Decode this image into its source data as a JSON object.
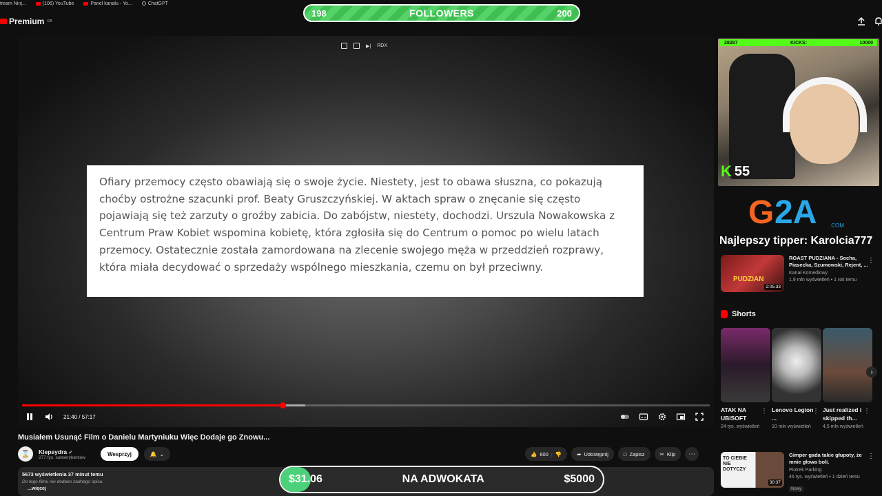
{
  "bookmarks": [
    {
      "label": "tream Ninj..."
    },
    {
      "label": "(106) YouTube"
    },
    {
      "label": "Panel kanału - Yo..."
    },
    {
      "label": "ChatGPT"
    }
  ],
  "header": {
    "logo_text": "Premium",
    "logo_country": "GB"
  },
  "followers_bar": {
    "current": "198",
    "label": "FOLLOWERS",
    "goal": "200",
    "progress": 0.99
  },
  "player": {
    "top_controls": {
      "label": "RDX"
    },
    "document_text": "Ofiary przemocy często obawiają się o swoje życie. Niestety, jest to obawa słuszna, co pokazują choćby ostrożne szacunki prof. Beaty Gruszczyńskiej. W aktach spraw o znęcanie się często pojawiają się też zarzuty o groźby zabicia. Do zabójstw, niestety, dochodzi. Urszula Nowakowska z Centrum Praw Kobiet wspomina kobietę, która zgłosiła się do Centrum o pomoc po wielu latach przemocy. Ostatecznie została zamordowana na zlecenie swojego męża w przeddzień rozprawy, która miała decydować o sprzedaży wspólnego mieszkania, czemu on był przeciwny.",
    "time": "21:40 / 57:17",
    "played_fraction": 0.378,
    "buffered_fraction": 0.412
  },
  "video": {
    "title": "Musiałem Usunąć Film o Danielu Martyniuku Więc Dodaje go Znowu...",
    "channel_name": "Klepsydra",
    "subscribers": "277 tys. subskrybentów",
    "support_label": "Wesprzyj",
    "like_count": "600",
    "share_label": "Udostępnij",
    "save_label": "Zapisz",
    "clip_label": "Klip",
    "more_label": "⋯"
  },
  "description": {
    "stats": "5673 wyświetlenia  37 minut temu",
    "text": "Do tego filmu nie dodano żadnego opisu.",
    "more": "...więcej"
  },
  "donation_bar": {
    "current": "$31.06",
    "label": "NA ADWOKATA",
    "goal": "$5000",
    "progress": 0.0062
  },
  "webcam": {
    "kick_left": "28287",
    "kick_label": "KICKS:",
    "kick_right": "10000",
    "kick_count": "55",
    "kick_letter": "K"
  },
  "sponsor": {
    "g2a_text": "G2A",
    "g2a_sub": ".COM",
    "tipper": "Najlepszy tipper: Karolcia777"
  },
  "recommendations": [
    {
      "title": "ROAST PUDZIANA - Socha, Piasecka, Szumowski, Rejent, ...",
      "channel": "Kanał Komediowy",
      "meta": "1,9 mln wyświetleń • 1 rok temu",
      "duration": "2:05:33",
      "thumb_text": "PUDZIAN"
    }
  ],
  "shorts": {
    "header": "Shorts",
    "items": [
      {
        "title": "ATAK NA UBISOFT",
        "views": "24 tys. wyświetleń"
      },
      {
        "title": "Lenovo Legion ...",
        "views": "10 mln wyświetleń"
      },
      {
        "title": "Just realized i skipped th...",
        "views": "4,5 mln wyświetleń"
      }
    ]
  },
  "recommendation_2": {
    "title": "Gimper gada takie głupoty, że mnie głowa boli.",
    "channel": "Piotrek Parking",
    "meta": "46 tys. wyświetleń • 1 dzień temu",
    "badge": "Nowy",
    "duration": "30:37",
    "thumb_text": "TO CIEBIE NIE DOTYCZY"
  }
}
